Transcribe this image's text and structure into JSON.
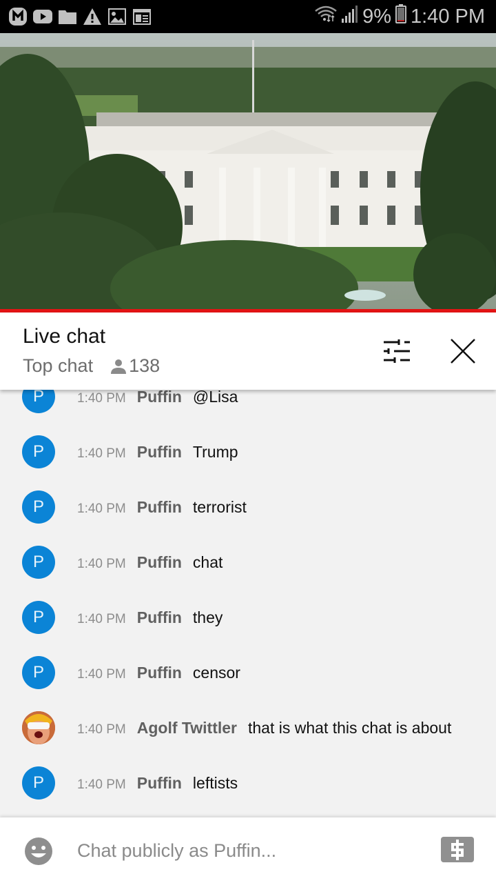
{
  "status_bar": {
    "left_icons": [
      "app-m-icon",
      "youtube-icon",
      "folder-icon",
      "warning-icon",
      "gallery-icon",
      "news-icon"
    ],
    "right_icons": [
      "wifi-icon",
      "signal-icon",
      "battery-icon"
    ],
    "battery": "9%",
    "time": "1:40 PM"
  },
  "video": {
    "description": "Live stream of the White House",
    "progress_percent": 100,
    "progress_color": "#e31414"
  },
  "chat_header": {
    "title": "Live chat",
    "mode": "Top chat",
    "viewer_count": "138",
    "filter_icon": "tune-icon",
    "close_icon": "close-icon"
  },
  "messages": [
    {
      "avatar": "P",
      "time": "1:40 PM",
      "author": "Puffin",
      "text": "@Lisa"
    },
    {
      "avatar": "P",
      "time": "1:40 PM",
      "author": "Puffin",
      "text": "Trump"
    },
    {
      "avatar": "P",
      "time": "1:40 PM",
      "author": "Puffin",
      "text": "terrorist"
    },
    {
      "avatar": "P",
      "time": "1:40 PM",
      "author": "Puffin",
      "text": "chat"
    },
    {
      "avatar": "P",
      "time": "1:40 PM",
      "author": "Puffin",
      "text": "they"
    },
    {
      "avatar": "P",
      "time": "1:40 PM",
      "author": "Puffin",
      "text": "censor"
    },
    {
      "avatar": "photo",
      "time": "1:40 PM",
      "author": "Agolf Twittler",
      "text": "that is what this chat is about"
    },
    {
      "avatar": "P",
      "time": "1:40 PM",
      "author": "Puffin",
      "text": "leftists"
    }
  ],
  "input_bar": {
    "placeholder": "Chat publicly as Puffin...",
    "emoji_icon": "emoji-icon",
    "superchat_icon": "dollar-icon"
  },
  "colors": {
    "avatar_blue": "#0b84d6",
    "accent_red": "#e31414"
  }
}
